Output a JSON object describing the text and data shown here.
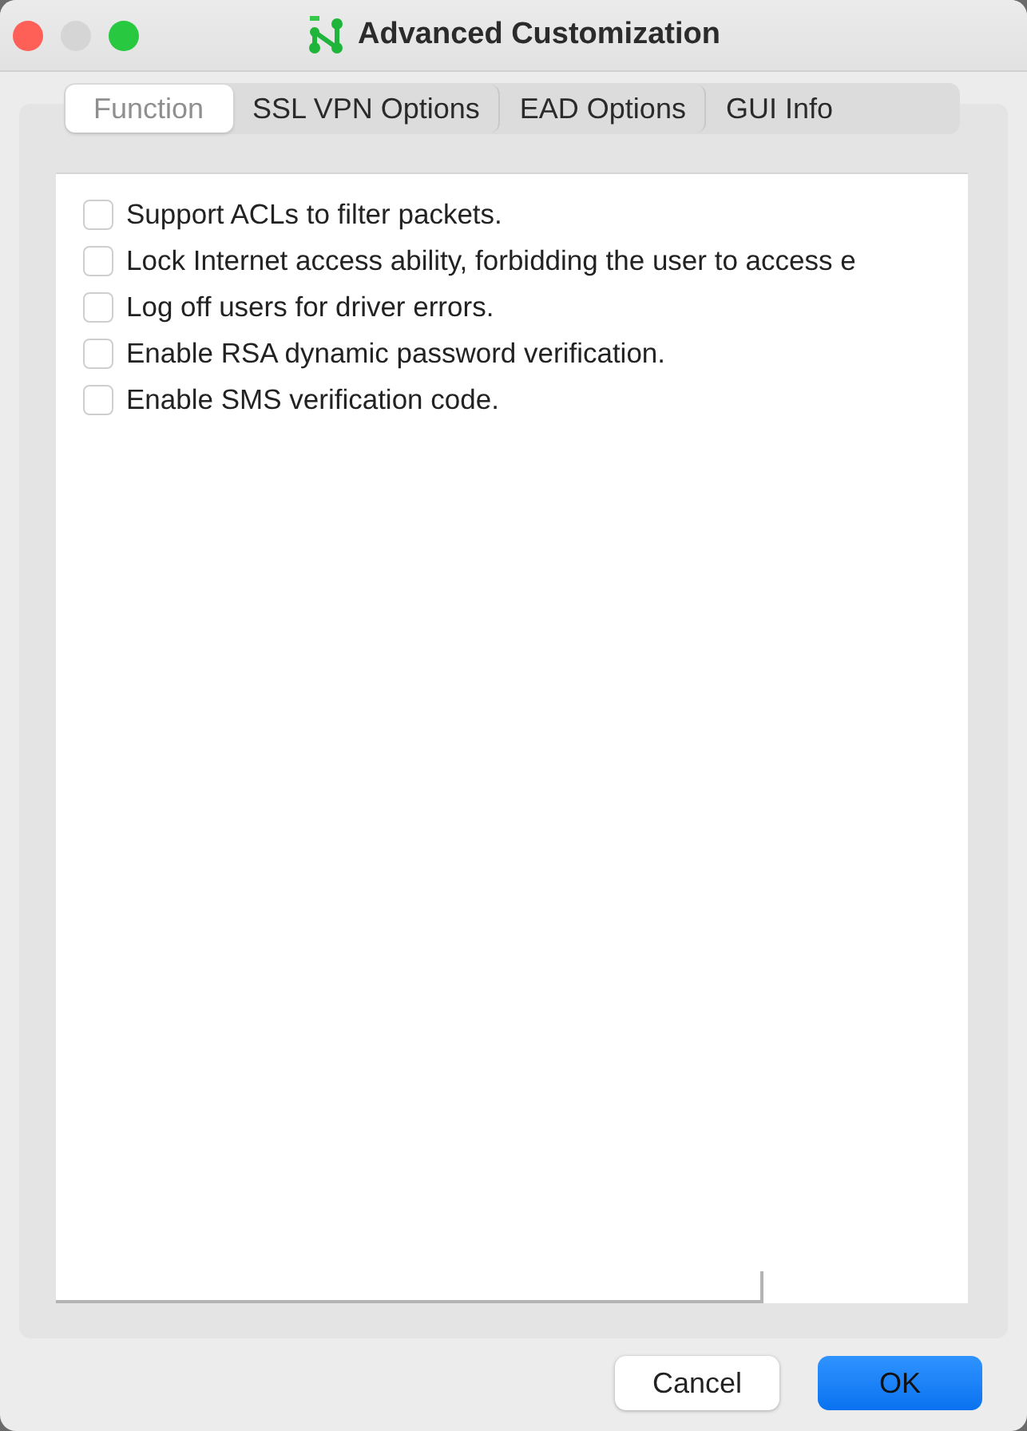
{
  "window": {
    "title": "Advanced Customization"
  },
  "tabs": [
    {
      "label": "Function",
      "selected": true
    },
    {
      "label": "SSL VPN Options",
      "selected": false
    },
    {
      "label": "EAD Options",
      "selected": false
    },
    {
      "label": "GUI Info",
      "selected": false
    }
  ],
  "options": [
    {
      "label": "Support ACLs to filter packets.",
      "checked": false
    },
    {
      "label": "Lock Internet access ability, forbidding the user to access e",
      "checked": false
    },
    {
      "label": "Log off users for driver errors.",
      "checked": false
    },
    {
      "label": "Enable RSA dynamic password verification.",
      "checked": false
    },
    {
      "label": "Enable SMS verification code.",
      "checked": false
    }
  ],
  "buttons": [
    {
      "label": "Cancel",
      "kind": "secondary"
    },
    {
      "label": "OK",
      "kind": "primary"
    }
  ]
}
